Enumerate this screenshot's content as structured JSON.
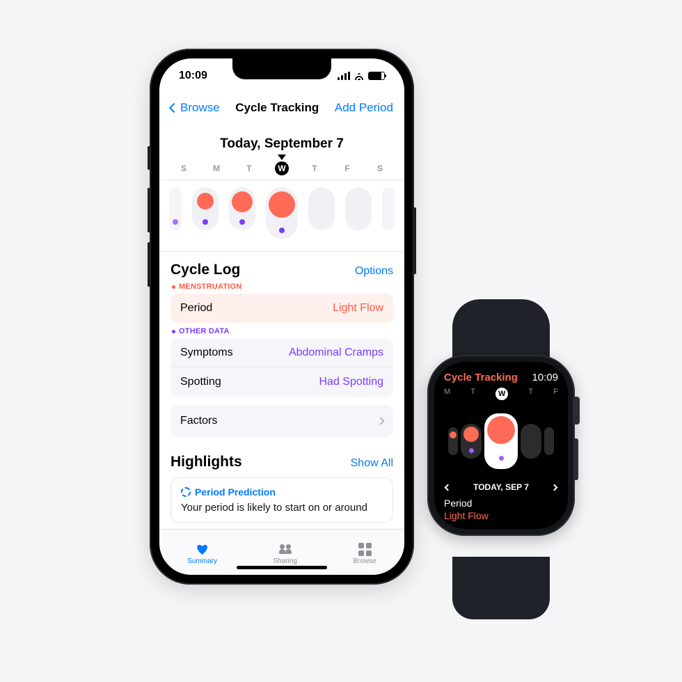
{
  "phone": {
    "status": {
      "time": "10:09"
    },
    "nav": {
      "back": "Browse",
      "title": "Cycle Tracking",
      "action": "Add Period"
    },
    "date": {
      "label": "Today, September 7"
    },
    "dow": [
      "S",
      "M",
      "T",
      "W",
      "T",
      "F",
      "S"
    ],
    "cycle_log": {
      "title": "Cycle Log",
      "options": "Options",
      "menstruation_label": "MENSTRUATION",
      "period_label": "Period",
      "period_value": "Light Flow",
      "other_label": "OTHER DATA",
      "symptoms_label": "Symptoms",
      "symptoms_value": "Abdominal Cramps",
      "spotting_label": "Spotting",
      "spotting_value": "Had Spotting",
      "factors_label": "Factors"
    },
    "highlights": {
      "title": "Highlights",
      "show_all": "Show All",
      "prediction_title": "Period Prediction",
      "prediction_text": "Your period is likely to start on or around"
    },
    "tabs": {
      "summary": "Summary",
      "sharing": "Sharing",
      "browse": "Browse"
    }
  },
  "watch": {
    "title": "Cycle Tracking",
    "time": "10:09",
    "dow": [
      "M",
      "T",
      "W",
      "T",
      "F"
    ],
    "date": "TODAY, SEP 7",
    "period_label": "Period",
    "period_value": "Light Flow"
  }
}
